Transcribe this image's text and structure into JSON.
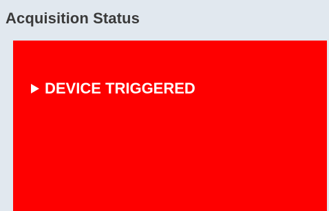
{
  "panel": {
    "title": "Acquisition Status"
  },
  "status": {
    "text": "DEVICE TRIGGERED",
    "indicator_icon": "play-triangle-icon",
    "background_color": "#fe0000",
    "text_color": "#ffffff"
  }
}
